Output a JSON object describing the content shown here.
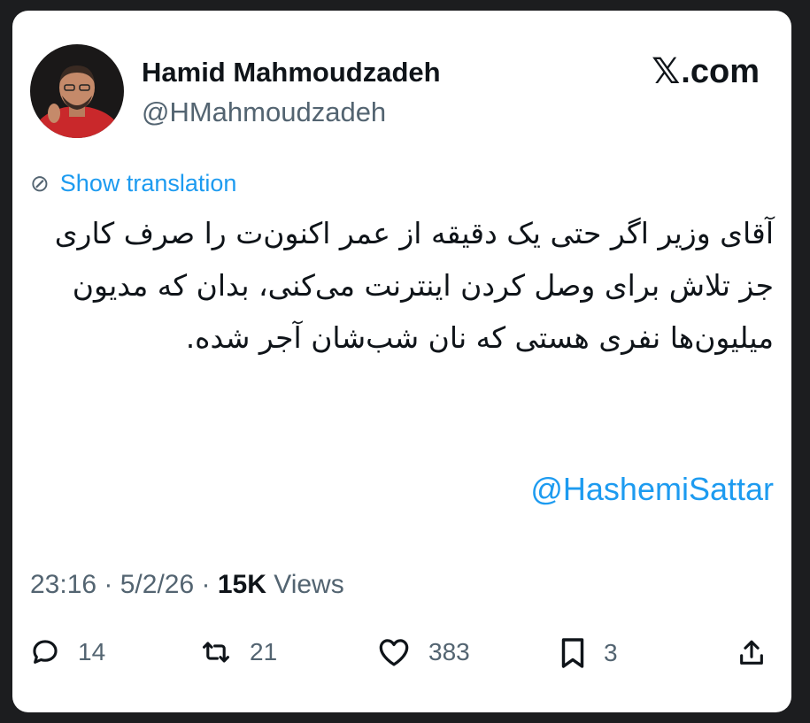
{
  "author": {
    "display_name": "Hamid Mahmoudzadeh",
    "handle": "@HMahmoudzadeh"
  },
  "brand": {
    "text": ".com"
  },
  "translate": {
    "label": "Show translation"
  },
  "tweet": {
    "text": "آقای وزیر اگر حتی یک دقیقه از عمر اکنون‌ت را صرف کاری جز تلاش برای وصل کردن اینترنت می‌کنی، بدان که مدیون میلیون‌ها نفری هستی که نان شب‌شان آجر شده.",
    "mention": "@HashemiSattar"
  },
  "meta": {
    "time": "23:16",
    "date": "5/2/26",
    "views_count": "15K",
    "views_label": "Views"
  },
  "actions": {
    "replies": "14",
    "reposts": "21",
    "likes": "383",
    "bookmarks": "3"
  },
  "icons": {
    "brand": "x-logo-icon",
    "translate": "globe-icon",
    "reply": "reply-icon",
    "repost": "repost-icon",
    "like": "heart-icon",
    "bookmark": "bookmark-icon",
    "share": "share-icon"
  },
  "colors": {
    "link": "#1d9bf0",
    "muted": "#536471",
    "text": "#0f1419",
    "background": "#1c1d1f"
  }
}
